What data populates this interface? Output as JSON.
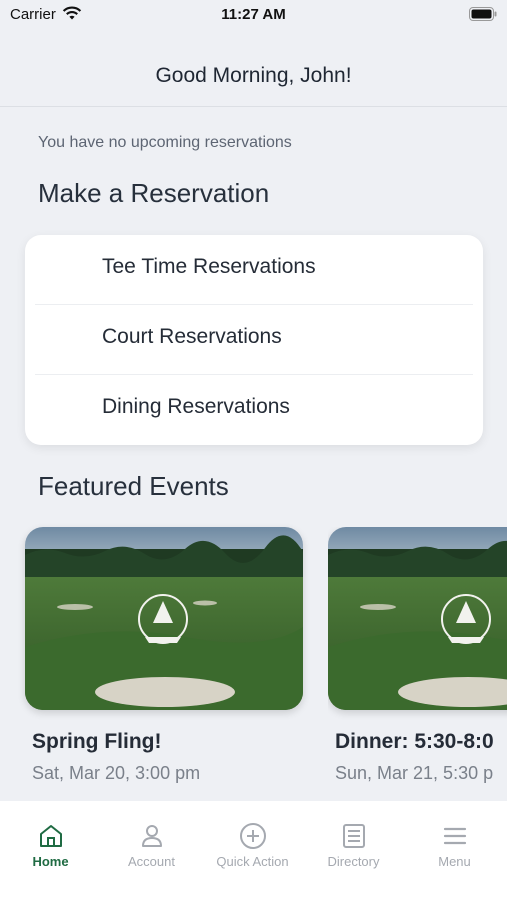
{
  "status_bar": {
    "carrier": "Carrier",
    "time": "11:27 AM"
  },
  "header": {
    "greeting": "Good Morning, John!"
  },
  "reservations": {
    "empty_text": "You have no upcoming reservations",
    "section_title": "Make a Reservation",
    "items": [
      {
        "label": "Tee Time Reservations"
      },
      {
        "label": "Court Reservations"
      },
      {
        "label": "Dining Reservations"
      }
    ]
  },
  "events": {
    "section_title": "Featured Events",
    "items": [
      {
        "title": "Spring Fling!",
        "date": "Sat, Mar 20, 3:00 pm"
      },
      {
        "title": "Dinner: 5:30-8:0",
        "date": "Sun, Mar 21, 5:30 p"
      }
    ]
  },
  "tab_bar": {
    "tabs": [
      {
        "label": "Home",
        "icon": "home-icon",
        "active": true
      },
      {
        "label": "Account",
        "icon": "person-icon",
        "active": false
      },
      {
        "label": "Quick Action",
        "icon": "plus-circle-icon",
        "active": false
      },
      {
        "label": "Directory",
        "icon": "list-icon",
        "active": false
      },
      {
        "label": "Menu",
        "icon": "menu-icon",
        "active": false
      }
    ]
  },
  "colors": {
    "accent": "#1f6b43",
    "inactive": "#a5a9b0",
    "background": "#eef0f4"
  }
}
